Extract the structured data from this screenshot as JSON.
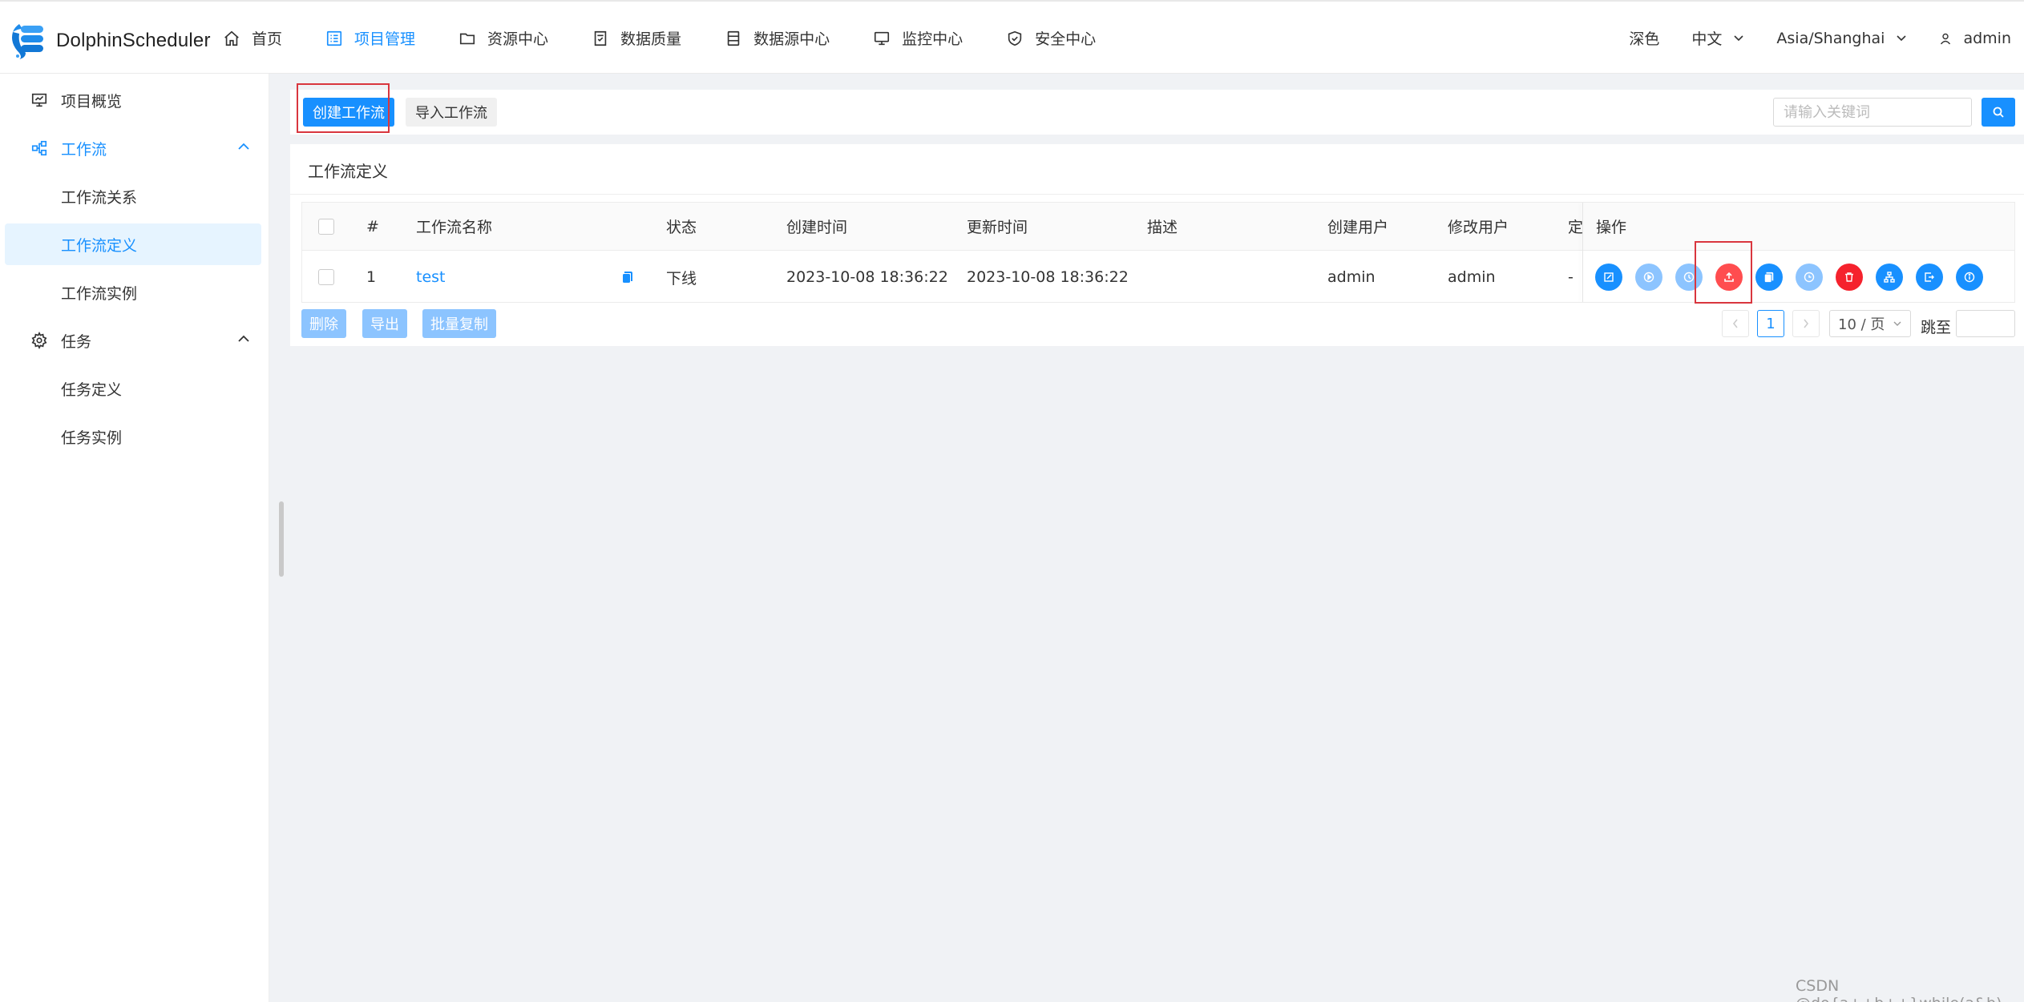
{
  "app": {
    "name": "DolphinScheduler"
  },
  "nav": {
    "items": [
      {
        "label": "首页",
        "icon": "home-icon"
      },
      {
        "label": "项目管理",
        "icon": "project-list-icon",
        "active": true
      },
      {
        "label": "资源中心",
        "icon": "folder-icon"
      },
      {
        "label": "数据质量",
        "icon": "data-quality-icon"
      },
      {
        "label": "数据源中心",
        "icon": "database-icon"
      },
      {
        "label": "监控中心",
        "icon": "monitor-icon"
      },
      {
        "label": "安全中心",
        "icon": "shield-icon"
      }
    ]
  },
  "header_right": {
    "theme": "深色",
    "language": "中文",
    "timezone": "Asia/Shanghai",
    "user": "admin"
  },
  "sidebar": {
    "items": [
      {
        "label": "项目概览",
        "icon": "presentation-icon"
      },
      {
        "label": "工作流",
        "icon": "workflow-icon",
        "expanded": true
      },
      {
        "label": "工作流关系"
      },
      {
        "label": "工作流定义",
        "selected": true
      },
      {
        "label": "工作流实例"
      },
      {
        "label": "任务",
        "icon": "gear-icon",
        "expanded": true
      },
      {
        "label": "任务定义"
      },
      {
        "label": "任务实例"
      }
    ]
  },
  "toolbar": {
    "create_label": "创建工作流",
    "import_label": "导入工作流",
    "search_placeholder": "请输入关键词"
  },
  "main": {
    "title": "工作流定义",
    "columns": [
      "#",
      "工作流名称",
      "状态",
      "创建时间",
      "更新时间",
      "描述",
      "创建用户",
      "修改用户",
      "定",
      "操作"
    ],
    "rows": [
      {
        "index": "1",
        "name": "test",
        "status": "下线",
        "created": "2023-10-08 18:36:22",
        "updated": "2023-10-08 18:36:22",
        "description": "",
        "creator": "admin",
        "modifier": "admin",
        "timing": "-"
      }
    ],
    "operations": [
      "edit-icon",
      "play-icon",
      "clock-icon",
      "upload-icon",
      "copy-icon",
      "timer-icon",
      "trash-icon",
      "tree-icon",
      "export-icon",
      "info-icon"
    ],
    "colors": {
      "primary": "#1890ff",
      "light": "#8cc4ff",
      "danger": "#f5222d"
    }
  },
  "footer_actions": {
    "delete_label": "删除",
    "export_label": "导出",
    "batch_copy_label": "批量复制"
  },
  "pagination": {
    "current": "1",
    "page_size": "10 / 页",
    "jump_label": "跳至"
  },
  "watermark": "CSDN @do{a++b++}while(a&b)"
}
